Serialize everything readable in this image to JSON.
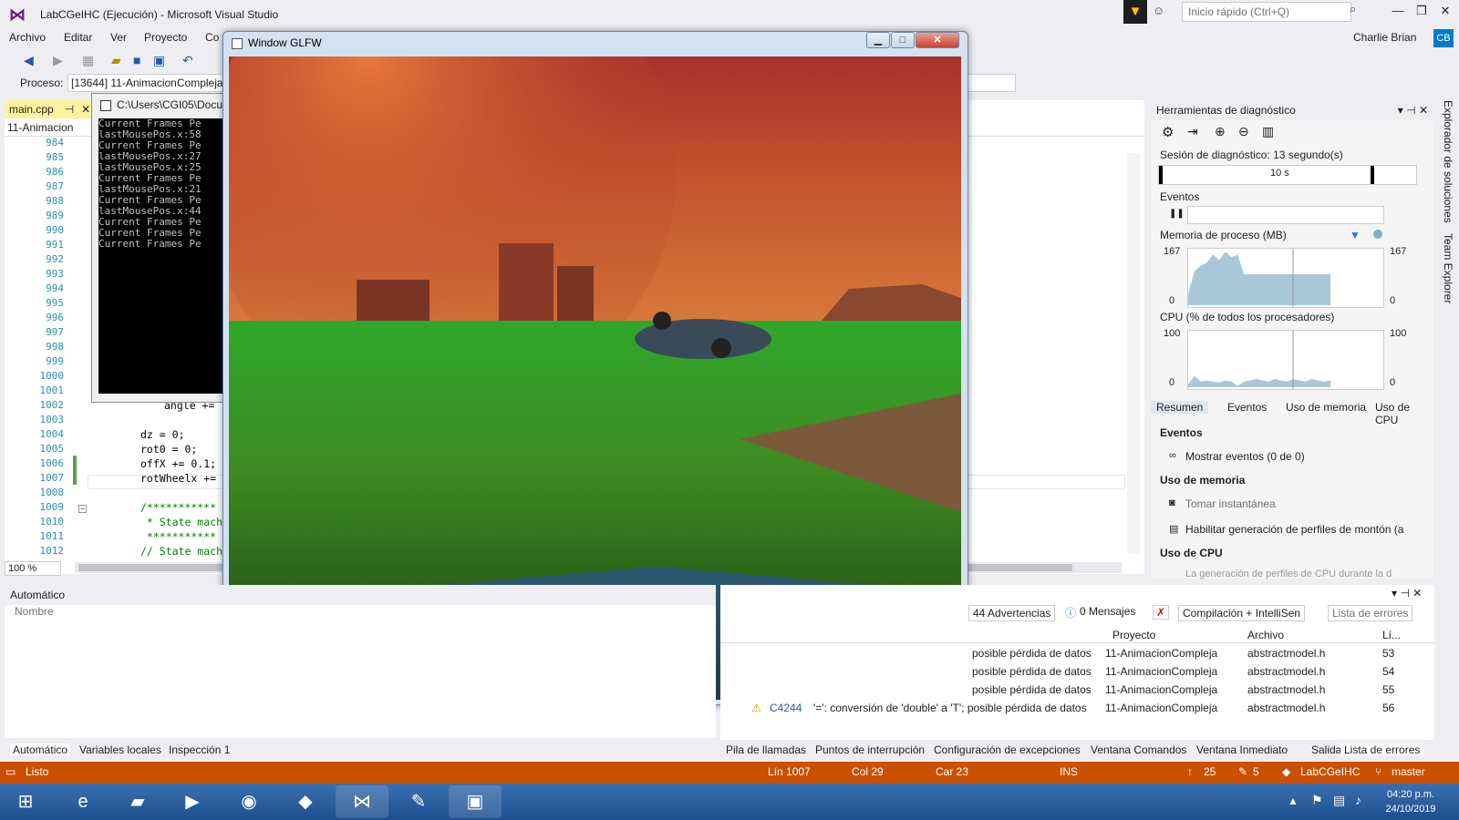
{
  "window": {
    "title": "LabCGeIHC (Ejecución) - Microsoft Visual Studio",
    "quick_launch_placeholder": "Inicio rápido (Ctrl+Q)",
    "user_name": "Charlie Brian",
    "user_initials": "CB"
  },
  "menu": [
    "Archivo",
    "Editar",
    "Ver",
    "Proyecto",
    "Co"
  ],
  "process": {
    "label": "Proceso:",
    "value": "[13644] 11-AnimacionCompleja"
  },
  "editor": {
    "tab_label": "main.cpp",
    "nav_selector": "11-Animacion",
    "zoom": "100 %",
    "line_numbers": [
      "984",
      "985",
      "986",
      "987",
      "988",
      "989",
      "990",
      "991",
      "992",
      "993",
      "994",
      "995",
      "996",
      "997",
      "998",
      "999",
      "1000",
      "1001",
      "1002",
      "1003",
      "1004",
      "1005",
      "1006",
      "1007",
      "1008",
      "1009",
      "1010",
      "1011",
      "1012"
    ],
    "code_lines": [
      {
        "line": "1002",
        "text": "angle +="
      },
      {
        "line": "1004",
        "text": "dz = 0;"
      },
      {
        "line": "1005",
        "text": "rot0 = 0;"
      },
      {
        "line": "1006",
        "text": "offX += 0.1;"
      },
      {
        "line": "1007",
        "text": "rotWheelx +="
      },
      {
        "line": "1009",
        "text": "/***********"
      },
      {
        "line": "1010",
        "text": " * State mach"
      },
      {
        "line": "1011",
        "text": " ***********"
      },
      {
        "line": "1012",
        "text": "// State mach"
      }
    ]
  },
  "console": {
    "title": "C:\\Users\\CGI05\\Docu",
    "lines": [
      "Current Frames Pe",
      "lastMousePos.x:58",
      "Current Frames Pe",
      "lastMousePos.x:27",
      "lastMousePos.x:25",
      "Current Frames Pe",
      "lastMousePos.x:21",
      "Current Frames Pe",
      "lastMousePos.x:44",
      "Current Frames Pe",
      "Current Frames Pe",
      "Current Frames Pe"
    ]
  },
  "glfw": {
    "title": "Window GLFW"
  },
  "diagnostics": {
    "title": "Herramientas de diagnóstico",
    "session": "Sesión de diagnóstico: 13 segundo(s)",
    "timeline_tick": "10 s",
    "events_label": "Eventos",
    "memory_label": "Memoria de proceso (MB)",
    "memory_max": "167",
    "memory_min": "0",
    "cpu_label": "CPU (% de todos los procesadores)",
    "cpu_max": "100",
    "cpu_min": "0",
    "tabs": [
      "Resumen",
      "Eventos",
      "Uso de memoria",
      "Uso de CPU"
    ],
    "sections": {
      "events_heading": "Eventos",
      "show_events": "Mostrar eventos (0 de 0)",
      "memory_heading": "Uso de memoria",
      "snapshot": "Tomar instantánea",
      "heap_profiling": "Habilitar generación de perfiles de montón (a",
      "cpu_heading": "Uso de CPU",
      "cpu_note": "La generación de perfiles de CPU durante la d"
    },
    "memory_series": [
      0.2,
      0.6,
      0.7,
      0.75,
      0.9,
      0.8,
      0.95,
      0.85,
      0.9,
      0.55,
      0.55,
      0.55,
      0.55,
      0.55,
      0.55,
      0.55,
      0.55,
      0.55,
      0.55,
      0.55,
      0.55,
      0.55,
      0.55,
      0.55
    ],
    "cpu_series": [
      0.05,
      0.2,
      0.1,
      0.12,
      0.1,
      0.08,
      0.12,
      0.1,
      0.02,
      0.1,
      0.12,
      0.15,
      0.12,
      0.1,
      0.15,
      0.12,
      0.1,
      0.14,
      0.12,
      0.1,
      0.15,
      0.12,
      0.1,
      0.12
    ]
  },
  "sidebar_right": {
    "solution_explorer": "Explorador de soluciones",
    "team_explorer": "Team Explorer"
  },
  "auto_panel": {
    "title": "Automático",
    "column": "Nombre",
    "tabs": [
      "Automático",
      "Variables locales",
      "Inspección 1"
    ]
  },
  "error_list": {
    "warnings": "44 Advertencias",
    "messages": "0 Mensajes",
    "filter": "Compilación + IntelliSen",
    "search_placeholder": "Lista de errores",
    "columns": [
      "Proyecto",
      "Archivo",
      "Lí..."
    ],
    "rows": [
      {
        "desc": "posible pérdida de datos",
        "project": "11-AnimacionCompleja",
        "file": "abstractmodel.h",
        "line": "53"
      },
      {
        "desc": "posible pérdida de datos",
        "project": "11-AnimacionCompleja",
        "file": "abstractmodel.h",
        "line": "54"
      },
      {
        "desc": "posible pérdida de datos",
        "project": "11-AnimacionCompleja",
        "file": "abstractmodel.h",
        "line": "55"
      },
      {
        "code": "C4244",
        "desc": "'=': conversión de 'double' a 'T'; posible pérdida de datos",
        "project": "11-AnimacionCompleja",
        "file": "abstractmodel.h",
        "line": "56"
      }
    ],
    "tabs": [
      "Pila de llamadas",
      "Puntos de interrupción",
      "Configuración de excepciones",
      "Ventana Comandos",
      "Ventana Inmediato",
      "Salida",
      "Lista de errores"
    ]
  },
  "status": {
    "ready": "Listo",
    "line": "Lín 1007",
    "col": "Col 29",
    "char": "Car 23",
    "ins": "INS",
    "up_count": "25",
    "edit_count": "5",
    "repo": "LabCGeIHC",
    "branch": "master"
  },
  "taskbar": {
    "time": "04:20 p.m.",
    "date": "24/10/2019",
    "apps": [
      "start-icon",
      "ie-icon",
      "explorer-icon",
      "media-icon",
      "chrome-icon",
      "git-icon",
      "vs-icon",
      "paint-icon",
      "app-icon"
    ]
  },
  "colors": {
    "accent": "#007acc",
    "status_bar": "#ca5100",
    "chart_fill": "#a8c8da"
  }
}
